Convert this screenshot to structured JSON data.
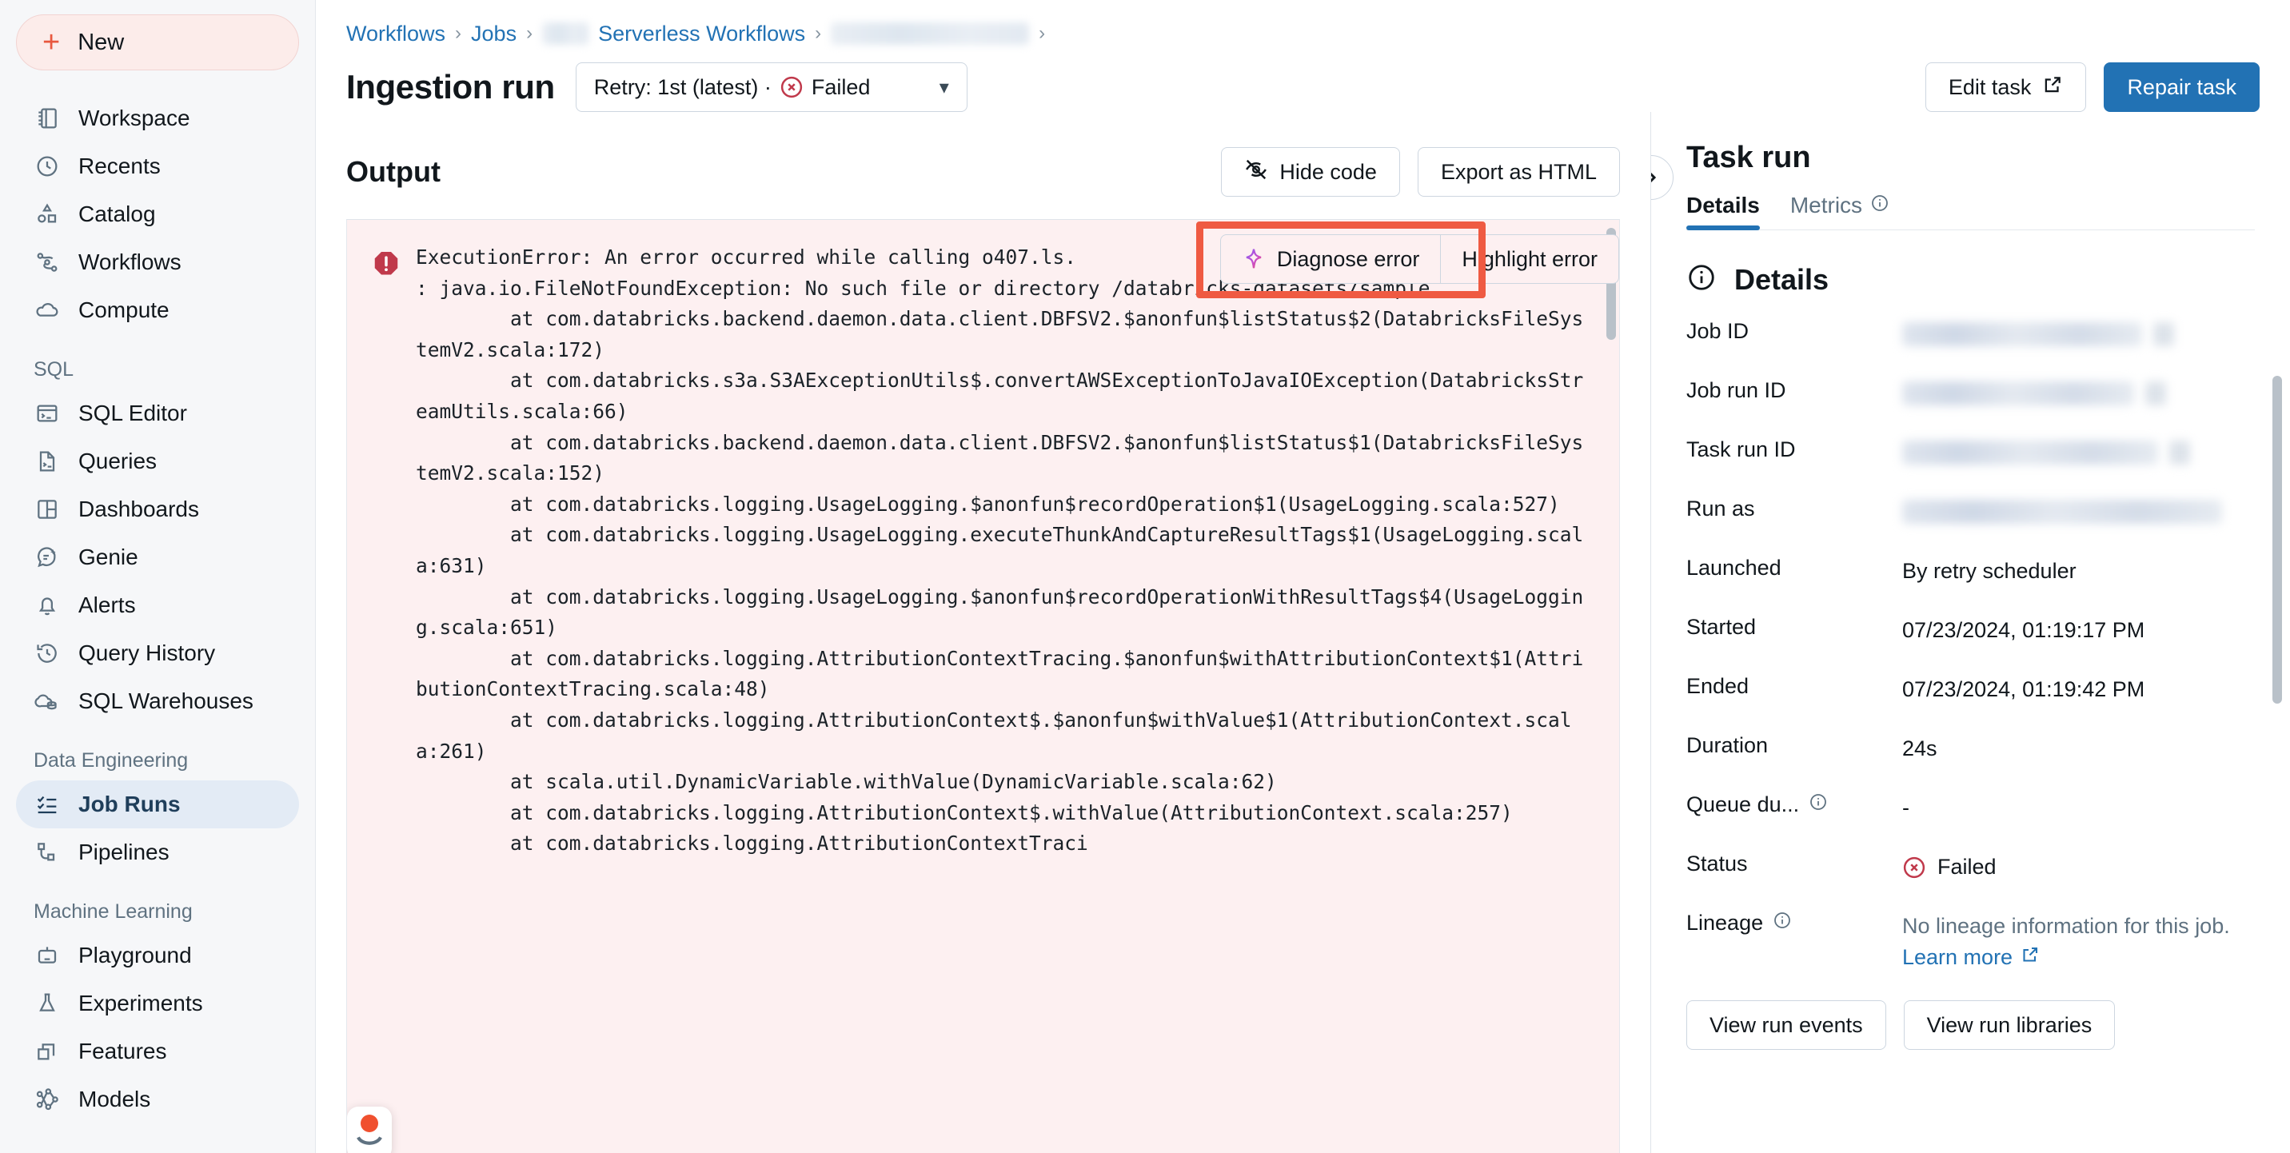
{
  "sidebar": {
    "new_button": {
      "label": "New",
      "icon": "plus-icon"
    },
    "top_items": [
      {
        "label": "Workspace",
        "icon": "workspace-icon"
      },
      {
        "label": "Recents",
        "icon": "clock-icon"
      },
      {
        "label": "Catalog",
        "icon": "catalog-icon"
      },
      {
        "label": "Workflows",
        "icon": "workflows-icon"
      },
      {
        "label": "Compute",
        "icon": "cloud-icon"
      }
    ],
    "sections": [
      {
        "title": "SQL",
        "items": [
          {
            "label": "SQL Editor",
            "icon": "terminal-window-icon"
          },
          {
            "label": "Queries",
            "icon": "file-query-icon"
          },
          {
            "label": "Dashboards",
            "icon": "dashboard-grid-icon"
          },
          {
            "label": "Genie",
            "icon": "genie-chat-icon"
          },
          {
            "label": "Alerts",
            "icon": "bell-icon"
          },
          {
            "label": "Query History",
            "icon": "history-icon"
          },
          {
            "label": "SQL Warehouses",
            "icon": "warehouse-cloud-icon"
          }
        ]
      },
      {
        "title": "Data Engineering",
        "items": [
          {
            "label": "Job Runs",
            "icon": "checklist-icon",
            "active": true
          },
          {
            "label": "Pipelines",
            "icon": "pipeline-icon"
          }
        ]
      },
      {
        "title": "Machine Learning",
        "items": [
          {
            "label": "Playground",
            "icon": "robot-icon"
          },
          {
            "label": "Experiments",
            "icon": "flask-icon"
          },
          {
            "label": "Features",
            "icon": "layers-icon"
          },
          {
            "label": "Models",
            "icon": "model-graph-icon"
          }
        ]
      }
    ]
  },
  "header": {
    "breadcrumb": [
      {
        "label": "Workflows",
        "type": "link"
      },
      {
        "label": "Jobs",
        "type": "link"
      },
      {
        "label": "",
        "type": "redacted-short"
      },
      {
        "label": "Serverless Workflows",
        "type": "link"
      },
      {
        "label": "",
        "type": "redacted-long"
      }
    ],
    "page_title": "Ingestion run",
    "retry_selector": {
      "text": "Retry: 1st (latest) ·",
      "status": "Failed",
      "chevron": "chevron-down-icon"
    },
    "edit_task_label": "Edit task",
    "repair_task_label": "Repair task"
  },
  "output": {
    "title": "Output",
    "hide_code_label": "Hide code",
    "export_label": "Export as HTML",
    "hover_actions": {
      "diagnose_label": "Diagnose error",
      "highlight_label": "Highlight error"
    },
    "error_text": "ExecutionError: An error occurred while calling o407.ls.\n: java.io.FileNotFoundException: No such file or directory /databricks-datasets/sample\n\tat com.databricks.backend.daemon.data.client.DBFSV2.$anonfun$listStatus$2(DatabricksFileSystemV2.scala:172)\n\tat com.databricks.s3a.S3AExceptionUtils$.convertAWSExceptionToJavaIOException(DatabricksStreamUtils.scala:66)\n\tat com.databricks.backend.daemon.data.client.DBFSV2.$anonfun$listStatus$1(DatabricksFileSystemV2.scala:152)\n\tat com.databricks.logging.UsageLogging.$anonfun$recordOperation$1(UsageLogging.scala:527)\n\tat com.databricks.logging.UsageLogging.executeThunkAndCaptureResultTags$1(UsageLogging.scala:631)\n\tat com.databricks.logging.UsageLogging.$anonfun$recordOperationWithResultTags$4(UsageLogging.scala:651)\n\tat com.databricks.logging.AttributionContextTracing.$anonfun$withAttributionContext$1(AttributionContextTracing.scala:48)\n\tat com.databricks.logging.AttributionContext$.$anonfun$withValue$1(AttributionContext.scala:261)\n\tat scala.util.DynamicVariable.withValue(DynamicVariable.scala:62)\n\tat com.databricks.logging.AttributionContext$.withValue(AttributionContext.scala:257)\n\tat com.databricks.logging.AttributionContextTraci"
  },
  "task_run": {
    "title": "Task run",
    "tabs": [
      {
        "label": "Details",
        "active": true
      },
      {
        "label": "Metrics",
        "active": false,
        "info_icon": "info-icon"
      }
    ],
    "details_heading": "Details",
    "rows": [
      {
        "label": "Job ID",
        "value": "",
        "redacted": true,
        "width_class": "w1"
      },
      {
        "label": "Job run ID",
        "value": "",
        "redacted": true,
        "width_class": "w2"
      },
      {
        "label": "Task run ID",
        "value": "",
        "redacted": true,
        "width_class": "w3"
      },
      {
        "label": "Run as",
        "value": "",
        "redacted": true,
        "width_class": "w4"
      },
      {
        "label": "Launched",
        "value": "By retry scheduler"
      },
      {
        "label": "Started",
        "value": "07/23/2024, 01:19:17 PM"
      },
      {
        "label": "Ended",
        "value": "07/23/2024, 01:19:42 PM"
      },
      {
        "label": "Duration",
        "value": "24s"
      },
      {
        "label": "Queue du...",
        "value": "-",
        "info_icon": true
      },
      {
        "label": "Status",
        "value": "Failed",
        "status": true
      },
      {
        "label": "Lineage",
        "value": "No lineage information for this job.",
        "info_icon": true,
        "link_label": "Learn more"
      }
    ],
    "buttons": [
      {
        "label": "View run events"
      },
      {
        "label": "View run libraries"
      }
    ]
  },
  "colors": {
    "accent_blue": "#2272b4",
    "error_red": "#c0394b",
    "highlight_orange": "#ef5a42",
    "new_red": "#e8583f",
    "error_bg": "#fdf0f1"
  }
}
